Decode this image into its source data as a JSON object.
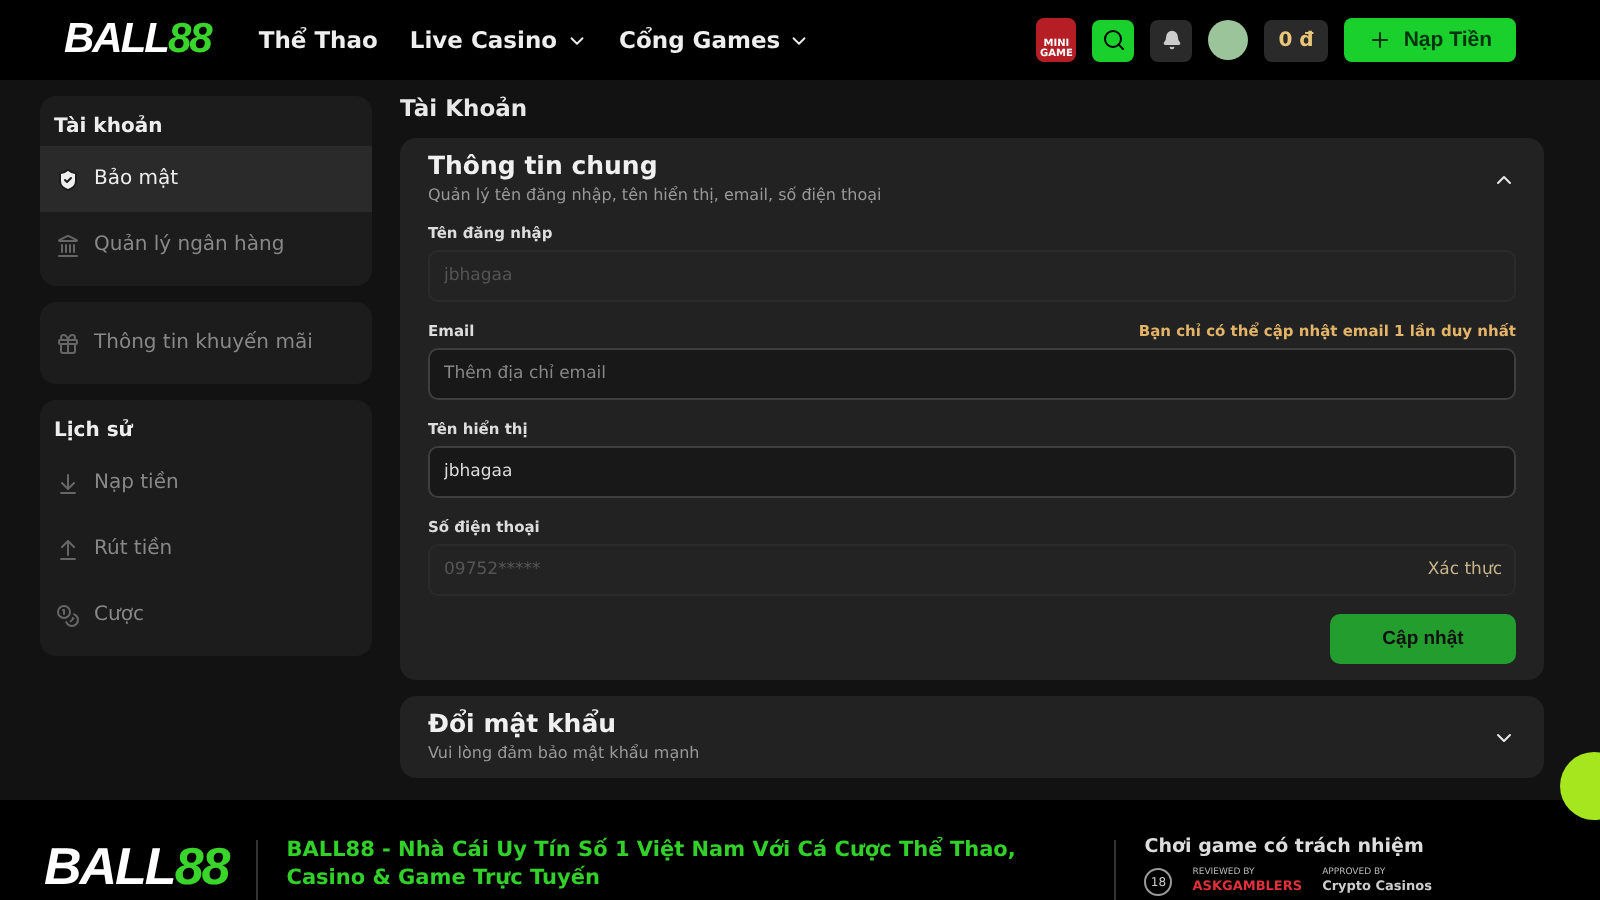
{
  "header": {
    "logo": {
      "part_1": "BALL",
      "part_2": "88"
    },
    "nav": [
      {
        "label": "Thể Thao",
        "dropdown": false
      },
      {
        "label": "Live Casino",
        "dropdown": true
      },
      {
        "label": "Cổng Games",
        "dropdown": true
      }
    ],
    "mini_game": "MINI GAME",
    "balance": "0 đ",
    "deposit_button": "Nạp Tiền"
  },
  "sidebar": {
    "groups": [
      {
        "title": "Tài khoản",
        "items": [
          {
            "label": "Bảo mật",
            "selected": true
          },
          {
            "label": "Quản lý ngân hàng",
            "selected": false
          }
        ]
      },
      {
        "items": [
          {
            "label": "Thông tin khuyến mãi",
            "selected": false
          }
        ]
      },
      {
        "title": "Lịch sử",
        "items": [
          {
            "label": "Nạp tiền",
            "selected": false
          },
          {
            "label": "Rút tiền",
            "selected": false
          },
          {
            "label": "Cược",
            "selected": false
          }
        ]
      }
    ]
  },
  "page_title": "Tài Khoản",
  "sections": [
    {
      "title": "Thông tin chung",
      "subtitle": "Quản lý tên đăng nhập, tên hiển thị, email, số điện thoại",
      "expanded": true,
      "fields": [
        {
          "label": "Tên đăng nhập",
          "value": "jbhagaa",
          "disabled": true
        },
        {
          "label": "Email",
          "note": "Bạn chỉ có thể cập nhật email 1 lần duy nhất",
          "placeholder": "Thêm địa chỉ email",
          "disabled": false
        },
        {
          "label": "Tên hiển thị",
          "value": "jbhagaa",
          "disabled": false
        },
        {
          "label": "Số điện thoại",
          "value": "09752*****",
          "disabled": true,
          "action": "Xác thực"
        }
      ],
      "submit": "Cập nhật"
    },
    {
      "title": "Đổi mật khẩu",
      "subtitle": "Vui lòng đảm bảo mật khẩu mạnh",
      "expanded": false
    }
  ],
  "footer": {
    "logo": {
      "part_1": "BALL",
      "part_2": "88"
    },
    "headline": "BALL88 - Nhà Cái Uy Tín Số 1 Việt Nam Với Cá Cược Thể Thao, Casino & Game Trực Tuyến",
    "responsible_title": "Chơi game có trách nhiệm",
    "badges": [
      {
        "kind": "age",
        "text": "18"
      },
      {
        "kind": "askgamblers",
        "top": "REVIEWED BY",
        "text": "ASKGAMBLERS"
      },
      {
        "kind": "crypto",
        "top": "APPROVED BY",
        "text": "Crypto Casinos"
      }
    ]
  }
}
